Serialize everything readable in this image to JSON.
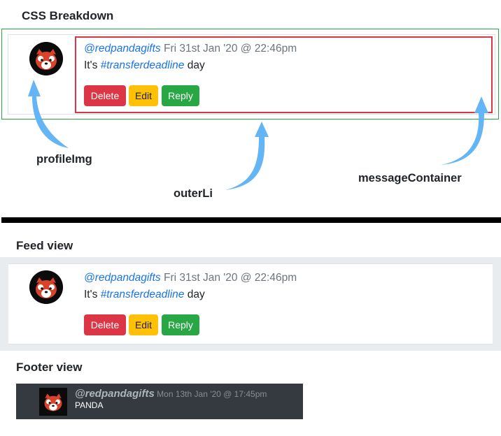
{
  "sections": {
    "breakdown_title": "CSS Breakdown",
    "feed_title": "Feed view",
    "footer_title": "Footer view"
  },
  "labels": {
    "profile_img": "profileImg",
    "outer_li": "outerLi",
    "message_container": "messageContainer"
  },
  "message": {
    "handle": "@redpandagifts",
    "date": " Fri 31st Jan '20 @ 22:46pm",
    "text_prefix": "It's ",
    "hashtag": "#transferdeadline",
    "text_suffix": " day"
  },
  "buttons": {
    "delete": "Delete",
    "edit": "Edit",
    "reply": "Reply"
  },
  "footer_message": {
    "handle": "@redpandagifts",
    "date": " Mon 13th Jan '20 @ 17:45pm",
    "text": "PANDA"
  },
  "colors": {
    "outer_border": "#28a745",
    "message_border": "#dc3545",
    "arrow": "#64b5f6",
    "link": "#1a73e8",
    "delete": "#dc3545",
    "edit": "#ffc107",
    "reply": "#28a745",
    "footer_bg": "#343a40"
  },
  "icons": [
    "red-panda-avatar-icon",
    "curved-arrow-icon"
  ]
}
